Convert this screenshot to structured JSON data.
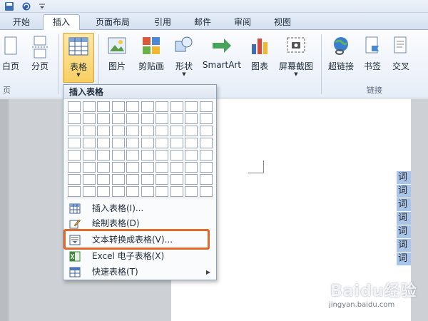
{
  "tabs": [
    {
      "label": "开始",
      "active": false
    },
    {
      "label": "插入",
      "active": true
    },
    {
      "label": "页面布局",
      "active": false
    },
    {
      "label": "引用",
      "active": false
    },
    {
      "label": "邮件",
      "active": false
    },
    {
      "label": "审阅",
      "active": false
    },
    {
      "label": "视图",
      "active": false
    }
  ],
  "ribbon": {
    "buttons": {
      "blank_page": "白页",
      "page_break": "分页",
      "table": "表格",
      "picture": "图片",
      "clipart": "剪贴画",
      "shapes": "形状",
      "smartart": "SmartArt",
      "chart": "图表",
      "screenshot": "屏幕截图",
      "hyperlink": "超链接",
      "bookmark": "书签",
      "crossref": "交叉"
    },
    "groups": {
      "pages": "页",
      "links": "链接"
    }
  },
  "dropdown": {
    "header": "插入表格",
    "grid_cols": 10,
    "grid_rows": 8,
    "items": [
      {
        "label": "插入表格(I)...",
        "has_arrow": false
      },
      {
        "label": "绘制表格(D)",
        "has_arrow": false
      },
      {
        "label": "文本转换成表格(V)...",
        "has_arrow": false
      },
      {
        "label": "Excel 电子表格(X)",
        "has_arrow": false
      },
      {
        "label": "快速表格(T)",
        "has_arrow": true
      }
    ],
    "arrow_glyph": "▶"
  },
  "document": {
    "selected_lines": [
      "词语",
      "词语",
      "词语",
      "词语",
      "词语",
      "词语",
      "词语"
    ]
  },
  "watermark": {
    "logo": "Baidu经验",
    "url": "jingyan.baidu.com"
  },
  "colors": {
    "highlight_border": "#e16a2b",
    "active_button": "#f7cf62",
    "selection": "#a9c6ea"
  }
}
